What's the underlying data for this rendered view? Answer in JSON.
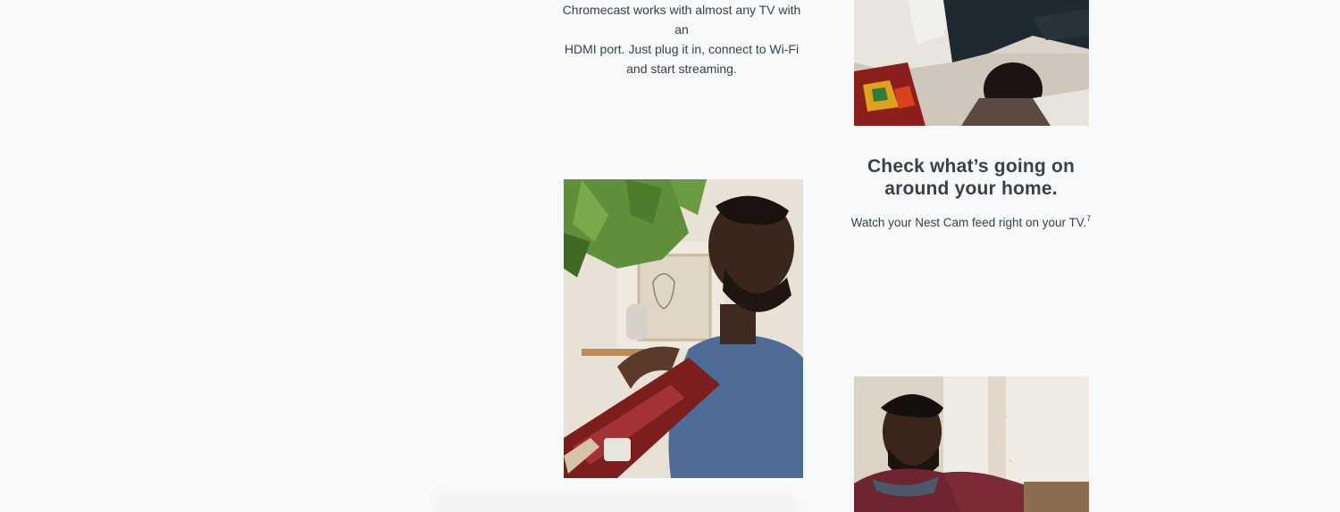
{
  "sections": {
    "chromecast": {
      "description_line1": "Chromecast works with almost any TV with an",
      "description_line2": "HDMI port. Just plug it in, connect to Wi-Fi",
      "description_line3": "and start streaming."
    },
    "nest_cam": {
      "heading_line1": "Check what’s going on",
      "heading_line2": "around your home.",
      "description": "Watch your Nest Cam feed right on your TV.",
      "footnote": "7"
    }
  },
  "images": {
    "top_right": "people-relaxing-on-rug-photo",
    "guitar": "man-playing-guitar-photo",
    "bottom_right": "man-in-maroon-sweater-photo"
  }
}
